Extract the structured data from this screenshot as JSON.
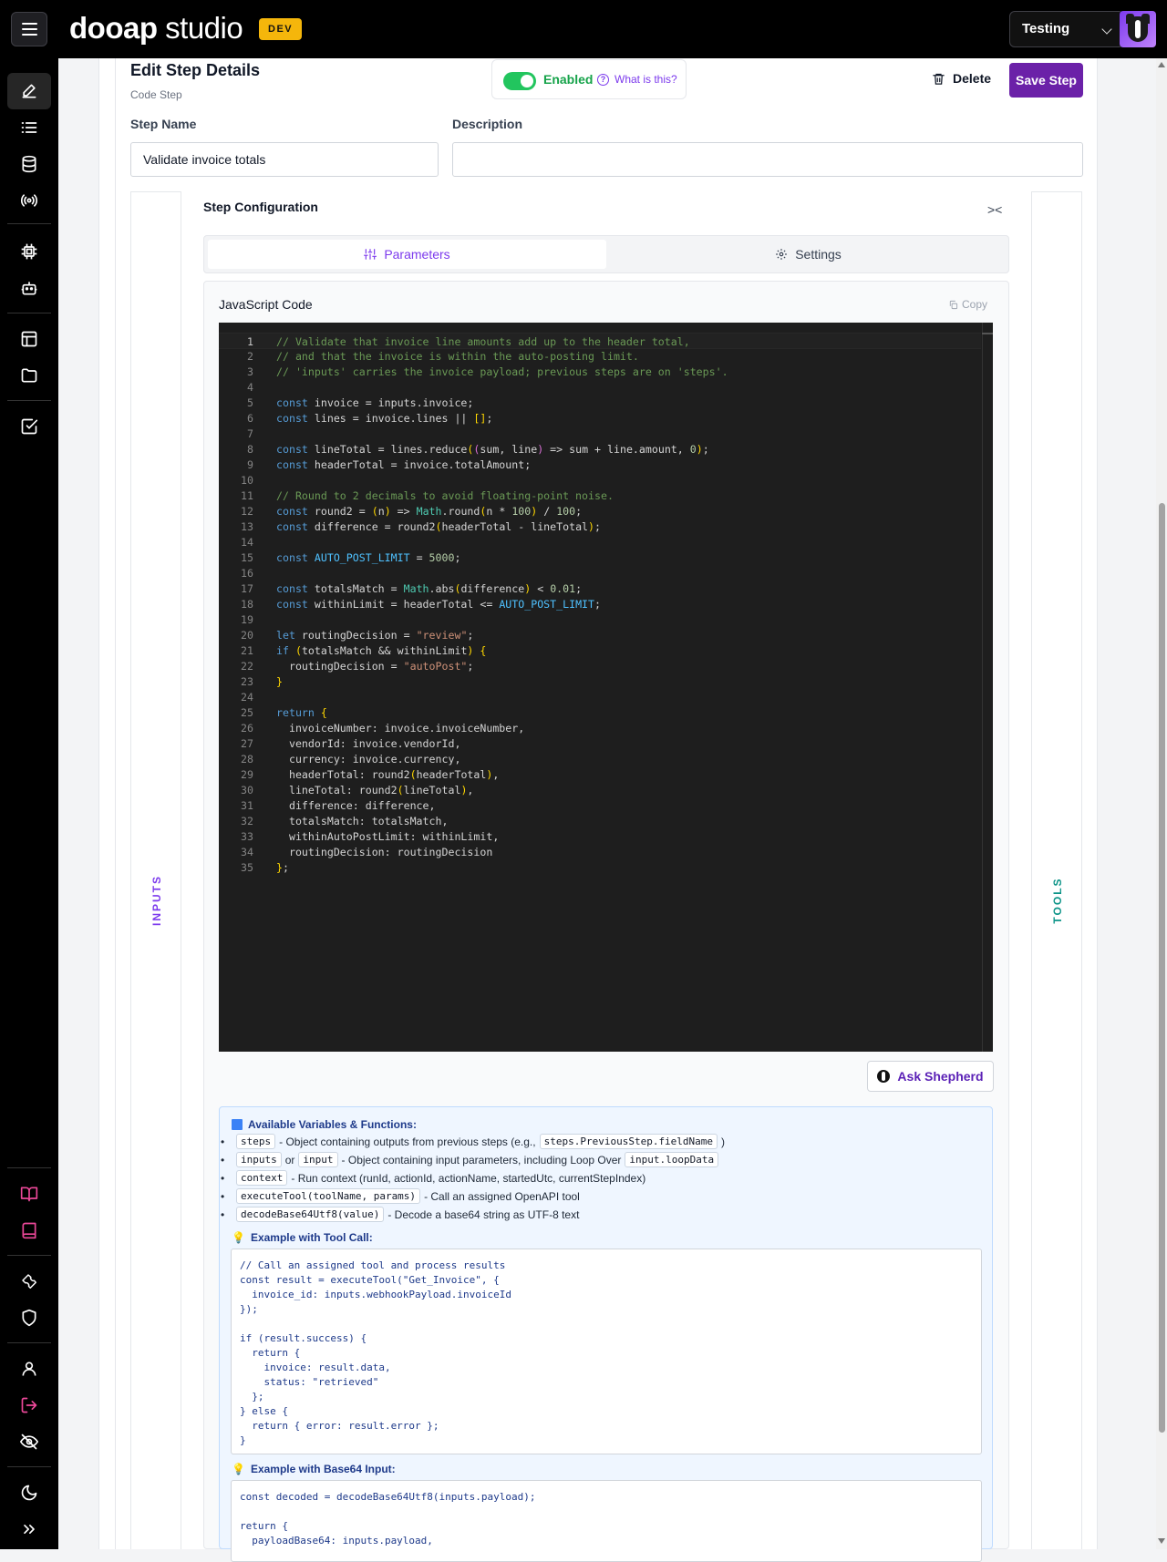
{
  "header": {
    "brand_bold": "dooap",
    "brand_rest": " studio",
    "env_badge": "DEV",
    "environment": "Testing"
  },
  "step": {
    "title": "Edit Step Details",
    "type": "Code Step",
    "enabled_label": "Enabled",
    "help_link": "What is this?",
    "delete_label": "Delete",
    "save_label": "Save Step",
    "name_label": "Step Name",
    "name_value": "Validate invoice totals",
    "description_label": "Description",
    "description_value": ""
  },
  "rails": {
    "inputs": "INPUTS",
    "tools": "TOOLS"
  },
  "config": {
    "title": "Step Configuration",
    "tabs": [
      {
        "label": "Parameters"
      },
      {
        "label": "Settings"
      }
    ],
    "code_title": "JavaScript Code",
    "copy_label": "Copy",
    "ask_label": "Ask Shepherd"
  },
  "code_lines": [
    "// Validate that invoice line amounts add up to the header total,",
    "// and that the invoice is within the auto-posting limit.",
    "// 'inputs' carries the invoice payload; previous steps are on 'steps'.",
    "",
    "const invoice = inputs.invoice;",
    "const lines = invoice.lines || [];",
    "",
    "const lineTotal = lines.reduce((sum, line) => sum + line.amount, 0);",
    "const headerTotal = invoice.totalAmount;",
    "",
    "// Round to 2 decimals to avoid floating-point noise.",
    "const round2 = (n) => Math.round(n * 100) / 100;",
    "const difference = round2(headerTotal - lineTotal);",
    "",
    "const AUTO_POST_LIMIT = 5000;",
    "",
    "const totalsMatch = Math.abs(difference) < 0.01;",
    "const withinLimit = headerTotal <= AUTO_POST_LIMIT;",
    "",
    "let routingDecision = \"review\";",
    "if (totalsMatch && withinLimit) {",
    "  routingDecision = \"autoPost\";",
    "}",
    "",
    "return {",
    "  invoiceNumber: invoice.invoiceNumber,",
    "  vendorId: invoice.vendorId,",
    "  currency: invoice.currency,",
    "  headerTotal: round2(headerTotal),",
    "  lineTotal: round2(lineTotal),",
    "  difference: difference,",
    "  totalsMatch: totalsMatch,",
    "  withinAutoPostLimit: withinLimit,",
    "  routingDecision: routingDecision",
    "};"
  ],
  "help": {
    "vars_title": "Available Variables & Functions:",
    "b1_code": "steps",
    "b1_text": "- Object containing outputs from previous steps (e.g.,",
    "b1_code2": "steps.PreviousStep.fieldName",
    "b1_tail": ")",
    "b2_code": "inputs",
    "b2_or": "or",
    "b2_code2": "input",
    "b2_text": "- Object containing input parameters, including Loop Over",
    "b2_code3": "input.loopData",
    "b3_code": "context",
    "b3_text": "- Run context (runId, actionId, actionName, startedUtc, currentStepIndex)",
    "b4_code": "executeTool(toolName, params)",
    "b4_text": "- Call an assigned OpenAPI tool",
    "b5_code": "decodeBase64Utf8(value)",
    "b5_text": "- Decode a base64 string as UTF-8 text",
    "ex1_title": "Example with Tool Call:",
    "ex1_code": "// Call an assigned tool and process results\nconst result = executeTool(\"Get_Invoice\", {\n  invoice_id: inputs.webhookPayload.invoiceId\n});\n\nif (result.success) {\n  return {\n    invoice: result.data,\n    status: \"retrieved\"\n  };\n} else {\n  return { error: result.error };\n}",
    "ex2_title": "Example with Base64 Input:",
    "ex2_code": "const decoded = decodeBase64Utf8(inputs.payload);\n\nreturn {\n  payloadBase64: inputs.payload,"
  }
}
